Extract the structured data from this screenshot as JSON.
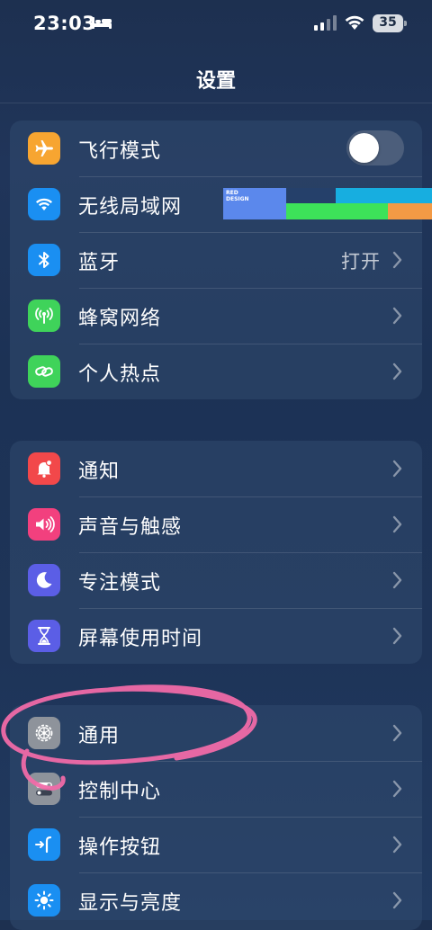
{
  "status_bar": {
    "time": "23:03",
    "battery_level": "35",
    "icons": [
      "bed-icon",
      "cellular-signal-icon",
      "wifi-icon",
      "battery-icon"
    ]
  },
  "nav": {
    "title": "设置"
  },
  "groups": [
    {
      "rows": [
        {
          "label": "飞行模式",
          "icon": "airplane-icon",
          "icon_color": "#f7a531",
          "control": "toggle",
          "toggle_on": false
        },
        {
          "label": "无线局域网",
          "icon": "wifi-icon",
          "icon_color": "#1a8ff2",
          "control": "none"
        },
        {
          "label": "蓝牙",
          "icon": "bluetooth-icon",
          "icon_color": "#1a8ff2",
          "control": "chevron",
          "value": "打开"
        },
        {
          "label": "蜂窝网络",
          "icon": "cellular-antenna-icon",
          "icon_color": "#3fd35a",
          "control": "chevron"
        },
        {
          "label": "个人热点",
          "icon": "hotspot-chain-icon",
          "icon_color": "#3fd35a",
          "control": "chevron"
        }
      ]
    },
    {
      "rows": [
        {
          "label": "通知",
          "icon": "notification-bell-icon",
          "icon_color": "#f2484a",
          "control": "chevron"
        },
        {
          "label": "声音与触感",
          "icon": "speaker-icon",
          "icon_color": "#f2407e",
          "control": "chevron"
        },
        {
          "label": "专注模式",
          "icon": "moon-icon",
          "icon_color": "#5b5ee6",
          "control": "chevron"
        },
        {
          "label": "屏幕使用时间",
          "icon": "hourglass-icon",
          "icon_color": "#5b5ee6",
          "control": "chevron"
        }
      ]
    },
    {
      "rows": [
        {
          "label": "通用",
          "icon": "gear-icon",
          "icon_color": "#8e939b",
          "control": "chevron"
        },
        {
          "label": "控制中心",
          "icon": "toggles-icon",
          "icon_color": "#8e939b",
          "control": "chevron"
        },
        {
          "label": "操作按钮",
          "icon": "action-button-icon",
          "icon_color": "#1a8ff2",
          "control": "chevron"
        },
        {
          "label": "显示与亮度",
          "icon": "sun-brightness-icon",
          "icon_color": "#1a8ff2",
          "control": "chevron"
        }
      ]
    }
  ],
  "overlay": {
    "watermark_text": "RED\nDESIGN",
    "annotation_color": "#f06aa8"
  }
}
